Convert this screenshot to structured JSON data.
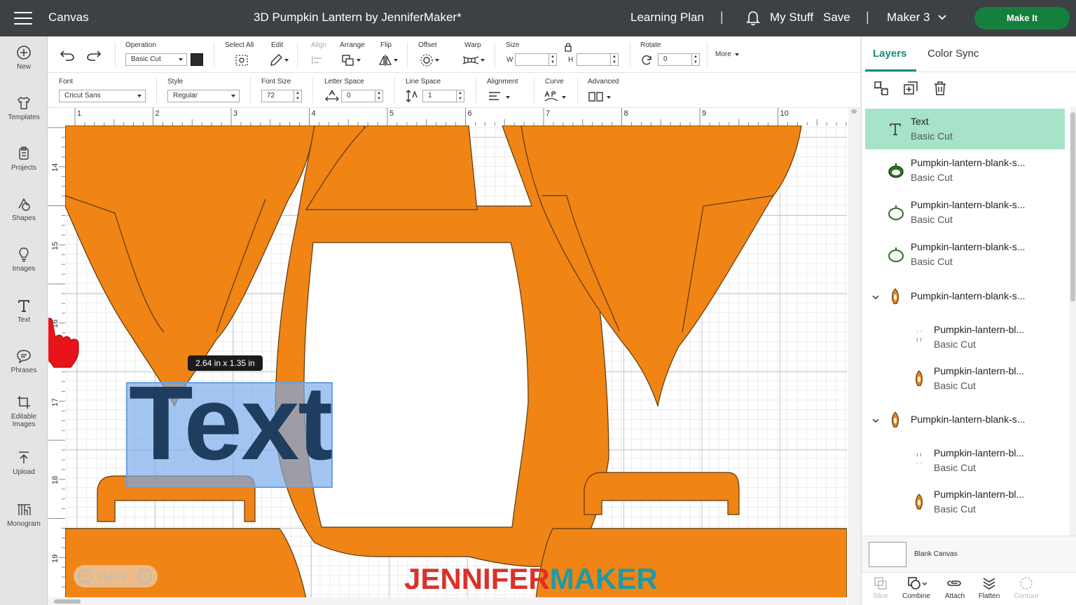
{
  "header": {
    "app_title": "Canvas",
    "doc_title": "3D Pumpkin Lantern by JenniferMaker*",
    "learning_plan": "Learning Plan",
    "separator": "|",
    "my_stuff": "My Stuff",
    "save": "Save",
    "machine": "Maker 3",
    "make_it": "Make It"
  },
  "sidebar": {
    "items": [
      {
        "label": "New",
        "icon": "plus-circle-icon"
      },
      {
        "label": "Templates",
        "icon": "shirt-icon"
      },
      {
        "label": "Projects",
        "icon": "projects-icon"
      },
      {
        "label": "Shapes",
        "icon": "shapes-icon"
      },
      {
        "label": "Images",
        "icon": "bulb-icon"
      },
      {
        "label": "Text",
        "icon": "text-icon"
      },
      {
        "label": "Phrases",
        "icon": "speech-bubble-icon"
      },
      {
        "label": "Editable",
        "label2": "Images",
        "icon": "editable-images-icon"
      },
      {
        "label": "Upload",
        "icon": "upload-icon"
      },
      {
        "label": "Monogram",
        "icon": "monogram-icon"
      }
    ]
  },
  "toolbar1": {
    "operation_label": "Operation",
    "operation_value": "Basic Cut",
    "select_all": "Select All",
    "edit": "Edit",
    "align": "Align",
    "arrange": "Arrange",
    "flip": "Flip",
    "offset": "Offset",
    "warp": "Warp",
    "size": "Size",
    "size_w_label": "W",
    "size_h_label": "H",
    "rotate": "Rotate",
    "rotate_value": "0",
    "more": "More"
  },
  "toolbar2": {
    "font_label": "Font",
    "font_value": "Cricut Sans",
    "style_label": "Style",
    "style_value": "Regular",
    "font_size_label": "Font Size",
    "font_size_value": "72",
    "letter_space_label": "Letter Space",
    "letter_space_value": "0",
    "line_space_label": "Line Space",
    "line_space_value": "1",
    "alignment_label": "Alignment",
    "curve_label": "Curve",
    "advanced_label": "Advanced"
  },
  "canvas": {
    "ruler_top": [
      "1",
      "2",
      "3",
      "4",
      "5",
      "6",
      "7",
      "8",
      "9",
      "10"
    ],
    "ruler_left": [
      "14",
      "15",
      "16",
      "17",
      "18",
      "19"
    ],
    "text_object": "Text",
    "dimension_tip": "2.64  in x 1.35  in",
    "zoom_out": "−",
    "zoom": "150%",
    "zoom_in": "+",
    "watermark_a": "JENNIFER",
    "watermark_b": "MAKER",
    "shape_color": "#f08415",
    "selection_color": "#6aa1e3"
  },
  "panel": {
    "tabs": [
      "Layers",
      "Color Sync"
    ],
    "active_tab": "Layers",
    "actions": [
      "group-icon",
      "duplicate-icon",
      "delete-icon"
    ],
    "layers": [
      {
        "name": "Text",
        "op": "Basic Cut",
        "selected": true,
        "kind": "text"
      },
      {
        "name": "Pumpkin-lantern-blank-s...",
        "op": "Basic Cut",
        "kind": "pumpkin-green"
      },
      {
        "name": "Pumpkin-lantern-blank-s...",
        "op": "Basic Cut",
        "kind": "pumpkin-outline"
      },
      {
        "name": "Pumpkin-lantern-blank-s...",
        "op": "Basic Cut",
        "kind": "pumpkin-outline"
      },
      {
        "name": "Pumpkin-lantern-blank-s...",
        "kind": "group"
      },
      {
        "name": "Pumpkin-lantern-bl...",
        "op": "Basic Cut",
        "kind": "child-dots"
      },
      {
        "name": "Pumpkin-lantern-bl...",
        "op": "Basic Cut",
        "kind": "child-lantern"
      },
      {
        "name": "Pumpkin-lantern-blank-s...",
        "kind": "group"
      },
      {
        "name": "Pumpkin-lantern-bl...",
        "op": "Basic Cut",
        "kind": "child-dots"
      },
      {
        "name": "Pumpkin-lantern-bl...",
        "op": "Basic Cut",
        "kind": "child-lantern"
      }
    ],
    "blank_canvas": "Blank Canvas",
    "bottom_actions": [
      {
        "label": "Slice",
        "enabled": false
      },
      {
        "label": "Combine",
        "enabled": true
      },
      {
        "label": "Attach",
        "enabled": true
      },
      {
        "label": "Flatten",
        "enabled": true
      },
      {
        "label": "Contour",
        "enabled": false
      }
    ],
    "accent_color": "#1d8a7a"
  }
}
